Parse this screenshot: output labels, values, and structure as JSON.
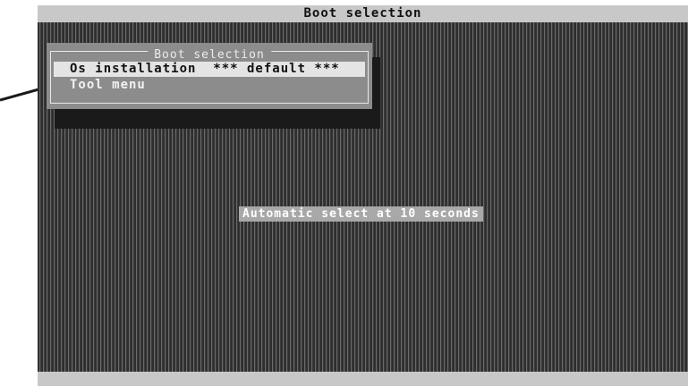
{
  "window": {
    "title": "Boot selection"
  },
  "menu": {
    "title": "Boot selection",
    "items": [
      {
        "label": "Os installation  *** default ***",
        "selected": true
      },
      {
        "label": "Tool menu",
        "selected": false
      }
    ]
  },
  "countdown": {
    "text": "Automatic select at 10 seconds"
  },
  "colors": {
    "screen_background": "#4a4a4a",
    "bar": "#c8c8c8",
    "menu_background": "#8c8c8c",
    "selected_item": "#e4e4e4",
    "countdown_background": "#a8a8a8"
  }
}
